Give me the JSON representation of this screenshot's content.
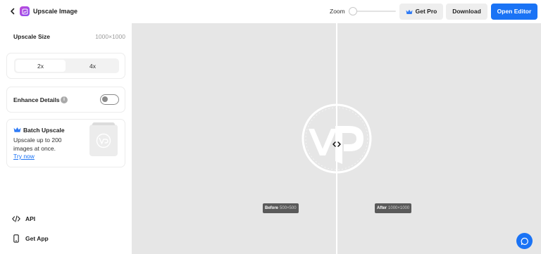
{
  "header": {
    "title": "Upscale Image",
    "zoom_label": "Zoom",
    "zoom_level": 0,
    "get_pro_label": "Get Pro",
    "download_label": "Download",
    "open_editor_label": "Open Editor"
  },
  "sidebar": {
    "upscale_size_label": "Upscale Size",
    "upscale_size_value": "1000×1000",
    "scale_options": [
      "2x",
      "4x"
    ],
    "selected_scale": "2x",
    "enhance_details_label": "Enhance Details",
    "enhance_details_on": false,
    "batch": {
      "title": "Batch Upscale",
      "desc_line1": "Upscale up to 200",
      "desc_line2": "images at once.",
      "link": "Try now"
    },
    "links": {
      "api": "API",
      "get_app": "Get App"
    }
  },
  "canvas": {
    "before_tag": "Before",
    "before_size": "500×500",
    "after_tag": "After",
    "after_size": "1000×1000",
    "divider_position": 0.5
  },
  "colors": {
    "accent": "#1a73f5",
    "canvas_bg": "#e6e6e6",
    "app_icon": "#b14ce0"
  },
  "icons": [
    "back-icon",
    "app-icon",
    "crown-icon",
    "info-icon",
    "code-icon",
    "phone-icon",
    "compare-handle-icon",
    "chat-icon"
  ]
}
